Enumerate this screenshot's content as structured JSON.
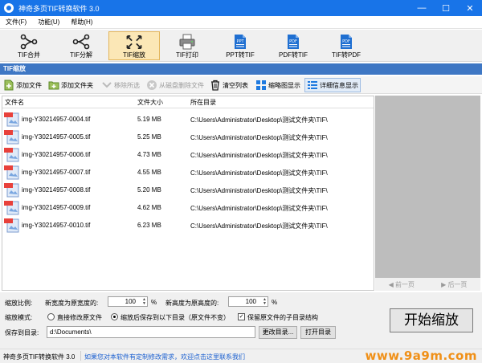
{
  "window": {
    "title": "神奇多页TIF转换软件 3.0",
    "minimize": "—",
    "maximize": "☐",
    "close": "✕"
  },
  "menu": [
    "文件(F)",
    "功能(U)",
    "帮助(H)"
  ],
  "toolbar": [
    {
      "label": "TIF合并",
      "icon": "merge-icon"
    },
    {
      "label": "TIF分解",
      "icon": "split-icon"
    },
    {
      "label": "TIF缩放",
      "icon": "resize-icon",
      "active": true
    },
    {
      "label": "TIF打印",
      "icon": "printer-icon"
    },
    {
      "label": "PPT转TIF",
      "icon": "ppt-file-icon",
      "badge": "PPT",
      "color": "#1f6fd1"
    },
    {
      "label": "PDF转TIF",
      "icon": "pdf-file-icon",
      "badge": "PDF",
      "color": "#1f6fd1"
    },
    {
      "label": "TIF转PDF",
      "icon": "pdf-file-icon",
      "badge": "PDF",
      "color": "#1f6fd1"
    }
  ],
  "section_title": "TIF缩放",
  "options": {
    "add_file": "添加文件",
    "add_folder": "添加文件夹",
    "remove_selected": "移除所选",
    "remove_from_disk": "从磁盘删除文件",
    "clear_list": "清空列表",
    "thumbnail_view": "缩略图显示",
    "detail_view": "详细信息显示"
  },
  "file_table": {
    "columns": [
      "文件名",
      "文件大小",
      "所在目录"
    ],
    "rows": [
      {
        "name": "img-Y30214957-0004.tif",
        "size": "5.19 MB",
        "dir": "C:\\Users\\Administrator\\Desktop\\测试文件夹\\TIF\\"
      },
      {
        "name": "img-Y30214957-0005.tif",
        "size": "5.25 MB",
        "dir": "C:\\Users\\Administrator\\Desktop\\测试文件夹\\TIF\\"
      },
      {
        "name": "img-Y30214957-0006.tif",
        "size": "4.73 MB",
        "dir": "C:\\Users\\Administrator\\Desktop\\测试文件夹\\TIF\\"
      },
      {
        "name": "img-Y30214957-0007.tif",
        "size": "4.55 MB",
        "dir": "C:\\Users\\Administrator\\Desktop\\测试文件夹\\TIF\\"
      },
      {
        "name": "img-Y30214957-0008.tif",
        "size": "5.20 MB",
        "dir": "C:\\Users\\Administrator\\Desktop\\测试文件夹\\TIF\\"
      },
      {
        "name": "img-Y30214957-0009.tif",
        "size": "4.62 MB",
        "dir": "C:\\Users\\Administrator\\Desktop\\测试文件夹\\TIF\\"
      },
      {
        "name": "img-Y30214957-0010.tif",
        "size": "6.23 MB",
        "dir": "C:\\Users\\Administrator\\Desktop\\测试文件夹\\TIF\\"
      }
    ]
  },
  "preview": {
    "prev": "前一页",
    "next": "后一页"
  },
  "settings": {
    "scale_label": "缩放比例:",
    "width_label": "新宽度为原宽度的:",
    "width_value": "100",
    "width_unit": "%",
    "height_label": "新高度为原高度的:",
    "height_value": "100",
    "height_unit": "%",
    "mode_label": "缩放模式:",
    "mode_direct": "直接修改原文件",
    "mode_save": "缩放后保存到以下目录（原文件不变）",
    "keep_struct": "保留原文件的子目录结构",
    "save_label": "保存到目录:",
    "save_path": "d:\\Documents\\",
    "change_dir": "更改目录...",
    "open_dir": "打开目录",
    "start": "开始缩放"
  },
  "status": {
    "version": "神奇多页TIF转换软件 3.0",
    "link": "如果您对本软件有定制修改需求，欢迎点击这里联系我们",
    "watermark": "www.9a9m.com"
  }
}
